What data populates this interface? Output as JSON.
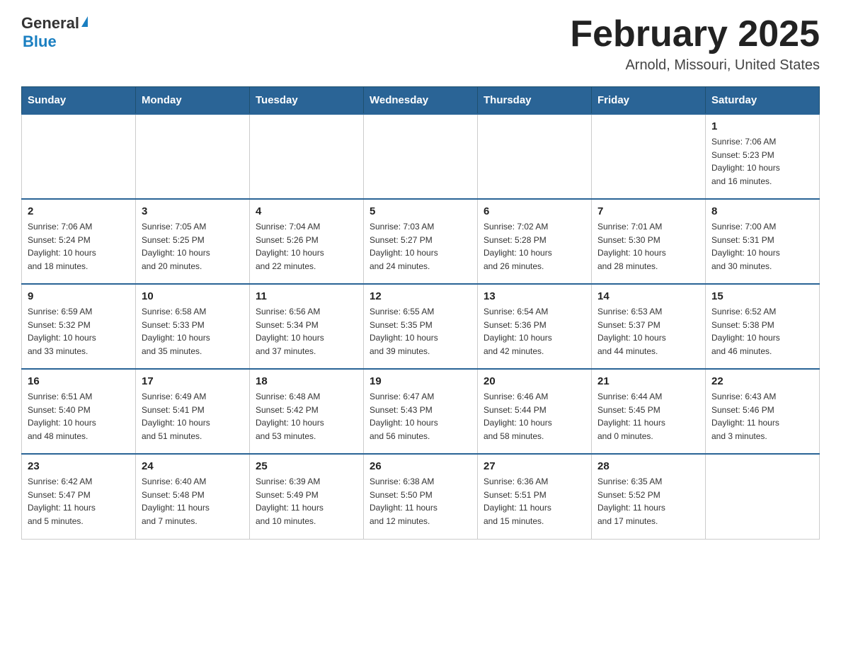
{
  "header": {
    "logo_general": "General",
    "logo_blue": "Blue",
    "month_title": "February 2025",
    "location": "Arnold, Missouri, United States"
  },
  "days_of_week": [
    "Sunday",
    "Monday",
    "Tuesday",
    "Wednesday",
    "Thursday",
    "Friday",
    "Saturday"
  ],
  "weeks": [
    [
      {
        "day": "",
        "info": ""
      },
      {
        "day": "",
        "info": ""
      },
      {
        "day": "",
        "info": ""
      },
      {
        "day": "",
        "info": ""
      },
      {
        "day": "",
        "info": ""
      },
      {
        "day": "",
        "info": ""
      },
      {
        "day": "1",
        "info": "Sunrise: 7:06 AM\nSunset: 5:23 PM\nDaylight: 10 hours\nand 16 minutes."
      }
    ],
    [
      {
        "day": "2",
        "info": "Sunrise: 7:06 AM\nSunset: 5:24 PM\nDaylight: 10 hours\nand 18 minutes."
      },
      {
        "day": "3",
        "info": "Sunrise: 7:05 AM\nSunset: 5:25 PM\nDaylight: 10 hours\nand 20 minutes."
      },
      {
        "day": "4",
        "info": "Sunrise: 7:04 AM\nSunset: 5:26 PM\nDaylight: 10 hours\nand 22 minutes."
      },
      {
        "day": "5",
        "info": "Sunrise: 7:03 AM\nSunset: 5:27 PM\nDaylight: 10 hours\nand 24 minutes."
      },
      {
        "day": "6",
        "info": "Sunrise: 7:02 AM\nSunset: 5:28 PM\nDaylight: 10 hours\nand 26 minutes."
      },
      {
        "day": "7",
        "info": "Sunrise: 7:01 AM\nSunset: 5:30 PM\nDaylight: 10 hours\nand 28 minutes."
      },
      {
        "day": "8",
        "info": "Sunrise: 7:00 AM\nSunset: 5:31 PM\nDaylight: 10 hours\nand 30 minutes."
      }
    ],
    [
      {
        "day": "9",
        "info": "Sunrise: 6:59 AM\nSunset: 5:32 PM\nDaylight: 10 hours\nand 33 minutes."
      },
      {
        "day": "10",
        "info": "Sunrise: 6:58 AM\nSunset: 5:33 PM\nDaylight: 10 hours\nand 35 minutes."
      },
      {
        "day": "11",
        "info": "Sunrise: 6:56 AM\nSunset: 5:34 PM\nDaylight: 10 hours\nand 37 minutes."
      },
      {
        "day": "12",
        "info": "Sunrise: 6:55 AM\nSunset: 5:35 PM\nDaylight: 10 hours\nand 39 minutes."
      },
      {
        "day": "13",
        "info": "Sunrise: 6:54 AM\nSunset: 5:36 PM\nDaylight: 10 hours\nand 42 minutes."
      },
      {
        "day": "14",
        "info": "Sunrise: 6:53 AM\nSunset: 5:37 PM\nDaylight: 10 hours\nand 44 minutes."
      },
      {
        "day": "15",
        "info": "Sunrise: 6:52 AM\nSunset: 5:38 PM\nDaylight: 10 hours\nand 46 minutes."
      }
    ],
    [
      {
        "day": "16",
        "info": "Sunrise: 6:51 AM\nSunset: 5:40 PM\nDaylight: 10 hours\nand 48 minutes."
      },
      {
        "day": "17",
        "info": "Sunrise: 6:49 AM\nSunset: 5:41 PM\nDaylight: 10 hours\nand 51 minutes."
      },
      {
        "day": "18",
        "info": "Sunrise: 6:48 AM\nSunset: 5:42 PM\nDaylight: 10 hours\nand 53 minutes."
      },
      {
        "day": "19",
        "info": "Sunrise: 6:47 AM\nSunset: 5:43 PM\nDaylight: 10 hours\nand 56 minutes."
      },
      {
        "day": "20",
        "info": "Sunrise: 6:46 AM\nSunset: 5:44 PM\nDaylight: 10 hours\nand 58 minutes."
      },
      {
        "day": "21",
        "info": "Sunrise: 6:44 AM\nSunset: 5:45 PM\nDaylight: 11 hours\nand 0 minutes."
      },
      {
        "day": "22",
        "info": "Sunrise: 6:43 AM\nSunset: 5:46 PM\nDaylight: 11 hours\nand 3 minutes."
      }
    ],
    [
      {
        "day": "23",
        "info": "Sunrise: 6:42 AM\nSunset: 5:47 PM\nDaylight: 11 hours\nand 5 minutes."
      },
      {
        "day": "24",
        "info": "Sunrise: 6:40 AM\nSunset: 5:48 PM\nDaylight: 11 hours\nand 7 minutes."
      },
      {
        "day": "25",
        "info": "Sunrise: 6:39 AM\nSunset: 5:49 PM\nDaylight: 11 hours\nand 10 minutes."
      },
      {
        "day": "26",
        "info": "Sunrise: 6:38 AM\nSunset: 5:50 PM\nDaylight: 11 hours\nand 12 minutes."
      },
      {
        "day": "27",
        "info": "Sunrise: 6:36 AM\nSunset: 5:51 PM\nDaylight: 11 hours\nand 15 minutes."
      },
      {
        "day": "28",
        "info": "Sunrise: 6:35 AM\nSunset: 5:52 PM\nDaylight: 11 hours\nand 17 minutes."
      },
      {
        "day": "",
        "info": ""
      }
    ]
  ]
}
